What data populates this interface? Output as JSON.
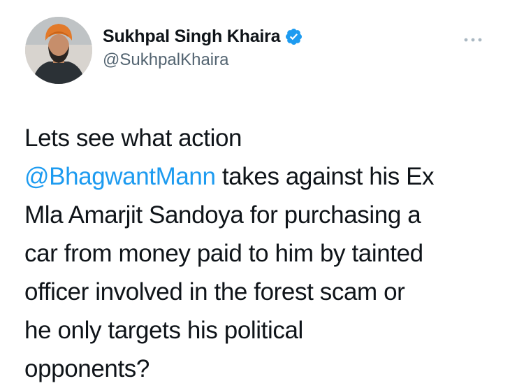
{
  "tweet": {
    "author": {
      "display_name": "Sukhpal Singh Khaira",
      "handle": "@SukhpalKhaira",
      "verified": true,
      "avatar_icon": "profile-photo",
      "verified_icon": "verified-badge-icon"
    },
    "more_icon": "more-options-icon",
    "text": {
      "line1": "Lets see what action",
      "line2_mention": "@BhagwantMann",
      "line2_rest": " takes against his Ex",
      "line3": "Mla Amarjit Sandoya for purchasing a",
      "line4": "car from money paid to him by tainted",
      "line5": "officer involved in the forest scam or",
      "line6": "he only targets his political",
      "line7": "opponents?"
    }
  },
  "colors": {
    "mention": "#1d9bf0",
    "verified": "#1d9bf0",
    "text": "#0f1419",
    "secondary": "#536471"
  }
}
